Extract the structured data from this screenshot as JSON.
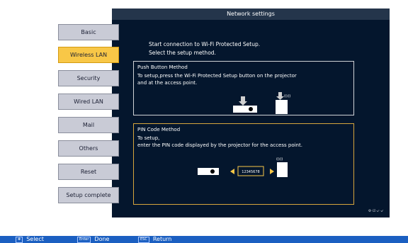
{
  "window": {
    "title": "Network settings"
  },
  "sidebar": {
    "items": [
      {
        "label": "Basic",
        "active": false
      },
      {
        "label": "Wireless LAN",
        "active": true
      },
      {
        "label": "Security",
        "active": false
      },
      {
        "label": "Wired LAN",
        "active": false
      },
      {
        "label": "Mail",
        "active": false
      },
      {
        "label": "Others",
        "active": false
      },
      {
        "label": "Reset",
        "active": false
      },
      {
        "label": "Setup complete",
        "active": false
      }
    ]
  },
  "main": {
    "intro_line1": "Start connection to Wi-Fi Protected Setup.",
    "intro_line2": "Select the setup method.",
    "push": {
      "title": "Push Button Method",
      "line1": "To setup,press the Wi-Fi Protected Setup button on the projector",
      "line2": "and at the access point."
    },
    "pin": {
      "title": "PIN Code Method",
      "line1": "To setup,",
      "line2": "enter the PIN code displayed by the projector for the access point.",
      "code": "12345678"
    },
    "page_hint": "⚙·☑·↙·↙"
  },
  "footer": {
    "select_label": "Select",
    "select_key": "✥",
    "done_label": "Done",
    "done_key": "Enter",
    "return_label": "Return",
    "return_key": "ESC"
  },
  "colors": {
    "accent": "#f8c747",
    "panel": "#04162d",
    "footer": "#1b5fc1"
  }
}
